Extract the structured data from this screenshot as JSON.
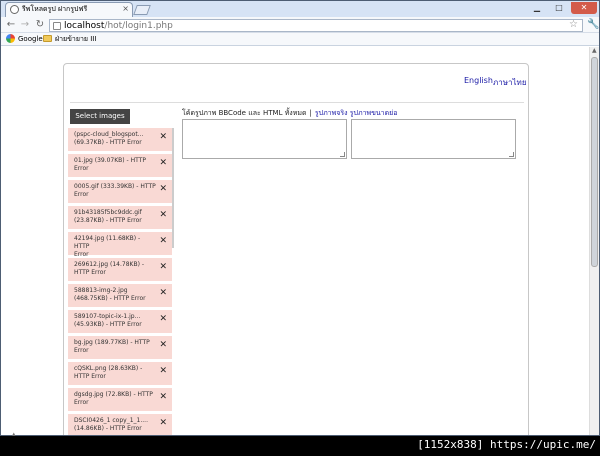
{
  "browser": {
    "tab_title": "รีพโหลดรูป ฝากรูปฟรี",
    "url_host": "localhost",
    "url_path": "/hot/login1.php",
    "bookmarks": [
      "Google",
      "ฝ่ายข้ายาย III"
    ]
  },
  "page": {
    "lang_en": "English",
    "lang_th": "ภาษาไทย",
    "select_button": "Select images",
    "code_label": "โค้ดรูปภาพ BBCode และ HTML ทั้งหมด",
    "link_full": "รูปภาพจริง",
    "link_thumb": "รูปภาพขนาดย่อ",
    "separator": "|",
    "files": [
      {
        "name": "(pspc-cloud_blogspot...",
        "detail": "(69.37KB) - HTTP Error"
      },
      {
        "name": "01.jpg (39.07KB) - HTTP",
        "detail": "Error"
      },
      {
        "name": "0005.gif (333.39KB) - HTTP",
        "detail": "Error"
      },
      {
        "name": "91b43185f5bc9ddc.gif",
        "detail": "(23.87KB) - HTTP Error"
      },
      {
        "name": "42194.jpg (11.68KB) - HTTP",
        "detail": "Error"
      },
      {
        "name": "269612.jpg (14.78KB) -",
        "detail": "HTTP Error"
      },
      {
        "name": "588813-img-2.jpg",
        "detail": "(468.75KB) - HTTP Error"
      },
      {
        "name": "589107-topic-ix-1.jp...",
        "detail": "(45.93KB) - HTTP Error"
      },
      {
        "name": "bg.jpg (189.77KB) - HTTP",
        "detail": "Error"
      },
      {
        "name": "cQSKL.png (28.63KB) -",
        "detail": "HTTP Error"
      },
      {
        "name": "dgsdg.jpg (72.8KB) - HTTP",
        "detail": "Error"
      },
      {
        "name": "DSCI0426_1 copy_1_1....",
        "detail": "(14.86KB) - HTTP Error"
      }
    ]
  },
  "footer": {
    "text": "[1152x838] https://upic.me/"
  }
}
